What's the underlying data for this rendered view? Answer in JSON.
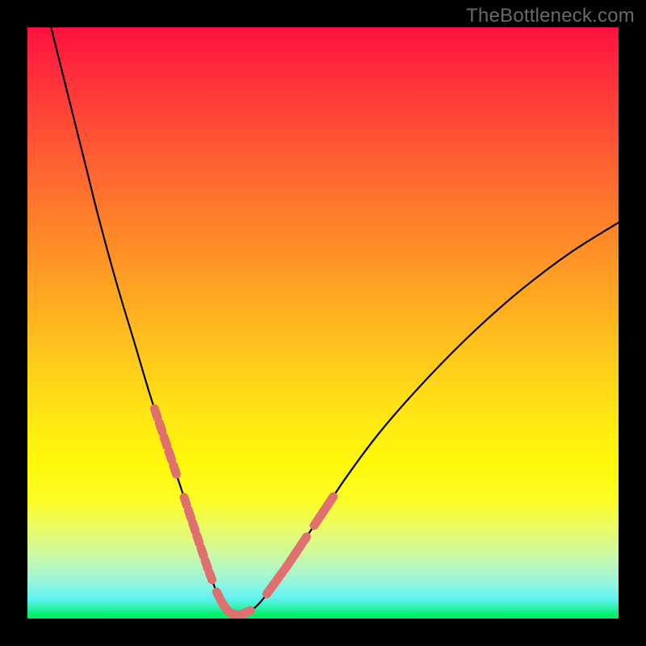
{
  "watermark": {
    "text": "TheBottleneck.com"
  },
  "colors": {
    "background": "#000000",
    "curve": "#000000",
    "marker": "#e07070",
    "watermark": "#69696b",
    "gradient_top": "#ff113f",
    "gradient_bottom": "#00ee5a"
  },
  "chart_data": {
    "type": "line",
    "title": "",
    "xlabel": "",
    "ylabel": "",
    "xlim": [
      0,
      100
    ],
    "ylim": [
      0,
      100
    ],
    "grid": false,
    "legend": false,
    "series": [
      {
        "name": "curve",
        "x": [
          4,
          6,
          8,
          10,
          12,
          15,
          18,
          21,
          24,
          27,
          29,
          30.5,
          32,
          33,
          34,
          35,
          36,
          38,
          40,
          44,
          48,
          54,
          60,
          68,
          76,
          84,
          92,
          100
        ],
        "y": [
          100,
          92,
          84,
          76,
          68,
          57,
          47,
          37,
          28,
          19,
          13,
          8.5,
          4.5,
          2.5,
          1.2,
          0.6,
          0.6,
          1.5,
          3.5,
          9,
          15,
          24,
          32,
          41,
          49,
          56,
          62,
          67
        ]
      }
    ],
    "markers": {
      "name": "highlighted-segments",
      "color": "#e07070",
      "segments": [
        {
          "x_range": [
            21.5,
            25.5
          ],
          "note": "left-branch upper"
        },
        {
          "x_range": [
            26.5,
            31.5
          ],
          "note": "left-branch lower"
        },
        {
          "x_range": [
            32.0,
            38.0
          ],
          "note": "valley"
        },
        {
          "x_range": [
            40.5,
            47.5
          ],
          "note": "right-branch lower"
        },
        {
          "x_range": [
            48.5,
            52.0
          ],
          "note": "right-branch upper"
        }
      ]
    },
    "annotations": []
  }
}
